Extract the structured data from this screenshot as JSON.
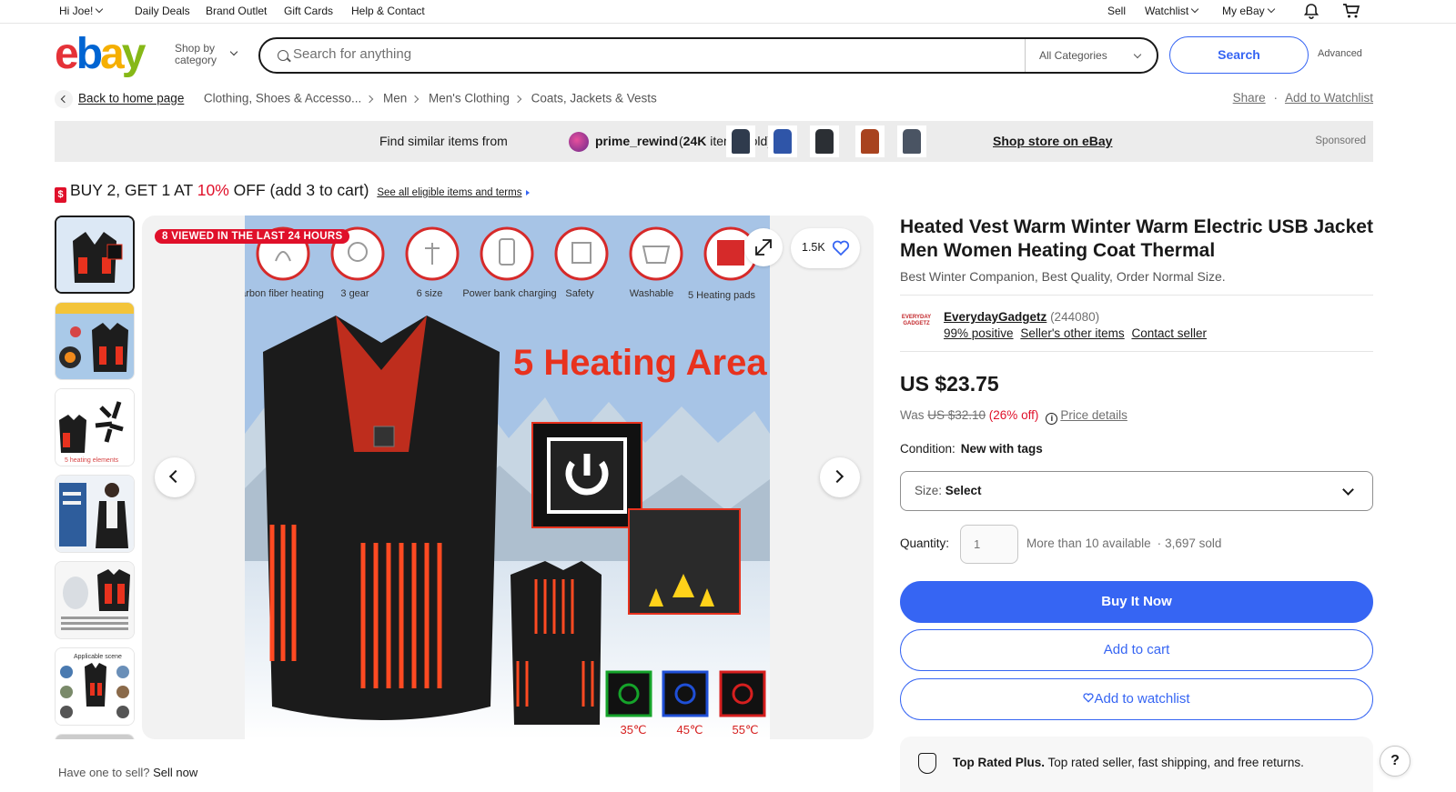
{
  "topbar": {
    "greeting": "Hi Joe!",
    "links": [
      "Daily Deals",
      "Brand Outlet",
      "Gift Cards",
      "Help & Contact"
    ],
    "right": {
      "sell": "Sell",
      "watchlist": "Watchlist",
      "my_ebay": "My eBay"
    }
  },
  "header": {
    "logo": [
      "e",
      "b",
      "a",
      "y"
    ],
    "shop_by_1": "Shop by",
    "shop_by_2": "category",
    "search_placeholder": "Search for anything",
    "category": "All Categories",
    "search_button": "Search",
    "advanced": "Advanced"
  },
  "breadcrumb": {
    "back": "Back to home page",
    "items": [
      "Clothing, Shoes & Accesso...",
      "Men",
      "Men's Clothing",
      "Coats, Jackets & Vests"
    ],
    "share": "Share",
    "add_watchlist": "Add to Watchlist"
  },
  "strip": {
    "find": "Find similar items from",
    "seller": "prime_rewind",
    "sold_open": "(",
    "sold_count": "24K",
    "sold_close": " items sold)",
    "thumb_colors": [
      "#2f3b4d",
      "#2f55a8",
      "#2b2f34",
      "#a8431f",
      "#4a5463"
    ],
    "shop_store": "Shop store on eBay",
    "sponsored": "Sponsored"
  },
  "promo": {
    "icon": "$",
    "text_pre": "BUY 2, GET 1 AT ",
    "pct": "10%",
    "text_post": " OFF (add 3 to cart)",
    "see_all": "See all eligible items and terms"
  },
  "gallery": {
    "viewed": "8 VIEWED IN THE LAST 24 HOURS",
    "watch_count": "1.5K",
    "features": [
      "Carbon fiber heating",
      "3 gear",
      "6 size",
      "Power bank charging",
      "Safety",
      "Washable",
      "5 Heating pads"
    ],
    "headline": "5 Heating Area",
    "temps": [
      "35℃",
      "45℃",
      "55℃"
    ],
    "temp_colors": [
      "#15a32a",
      "#1f4fd6",
      "#d61f1f"
    ],
    "thumb_captions": [
      "5 heating elements",
      "Applicable scene"
    ]
  },
  "product": {
    "title": "Heated Vest Warm Winter Warm Electric USB Jacket Men Women Heating Coat Thermal",
    "subtitle": "Best Winter Companion, Best Quality, Order Normal Size.",
    "seller_logo": "EVERYDAY GADGETZ",
    "seller_name": "EverydayGadgetz",
    "seller_count": " (244080)",
    "positive": "99% positive",
    "other_items": "Seller's other items",
    "contact": "Contact seller",
    "price": "US $23.75",
    "was_label": "Was ",
    "was_price": "US $32.10",
    "discount": " (26% off)",
    "price_details": "Price details",
    "condition_label": "Condition:",
    "condition_value": "New with tags",
    "size_label": "Size: ",
    "size_value": "Select",
    "quantity_label": "Quantity:",
    "quantity_value": "1",
    "available": "More than 10 available",
    "sold": "3,697 sold",
    "buy_now": "Buy It Now",
    "add_cart": "Add to cart",
    "add_watch": "Add to watchlist",
    "top_rated_bold": "Top Rated Plus.",
    "top_rated_rest": " Top rated seller, fast shipping, and free returns."
  },
  "footer": {
    "have_one": "Have one to sell? ",
    "sell_now": "Sell now",
    "help": "?"
  }
}
